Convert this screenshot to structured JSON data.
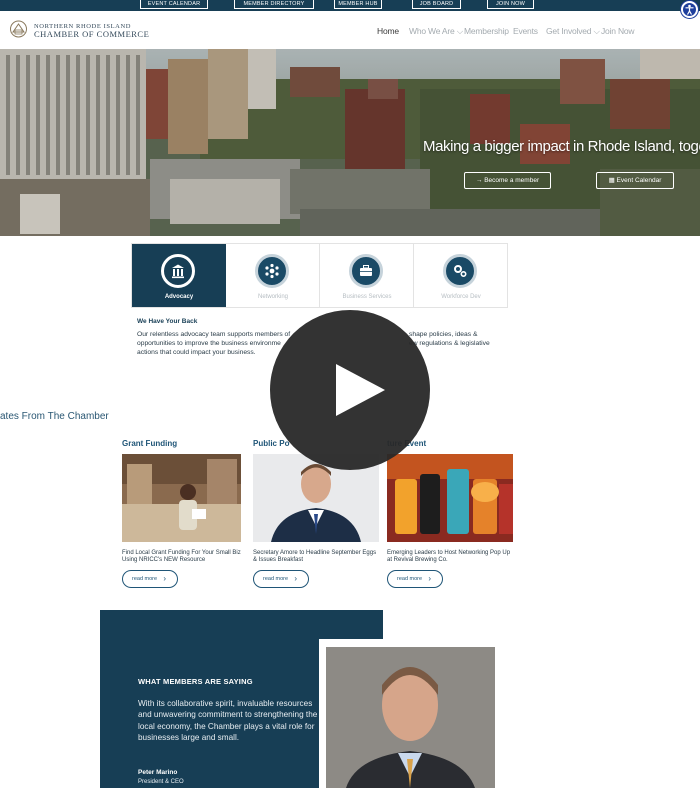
{
  "utility_bar": {
    "items": [
      "EVENT CALENDAR",
      "MEMBER DIRECTORY",
      "MEMBER HUB",
      "JOB BOARD",
      "JOIN NOW"
    ]
  },
  "logo": {
    "line1": "Northern Rhode Island",
    "line2": "Chamber of Commerce"
  },
  "nav": {
    "items": [
      {
        "label": "Home"
      },
      {
        "label": "Who We Are ⌵"
      },
      {
        "label": "Membership"
      },
      {
        "label": "Events"
      },
      {
        "label": "Get Involved ⌵"
      },
      {
        "label": "Join Now"
      }
    ]
  },
  "hero": {
    "headline": "Making a bigger impact in Rhode Island, together",
    "btn_member": "→  Become a member",
    "btn_calendar": "▦  Event Calendar"
  },
  "tabs": [
    {
      "label": "Advocacy",
      "icon": "bank-icon"
    },
    {
      "label": "Networking",
      "icon": "people-network-icon"
    },
    {
      "label": "Business Services",
      "icon": "briefcase-icon"
    },
    {
      "label": "Workforce Dev",
      "icon": "gears-icon"
    }
  ],
  "advocacy": {
    "title": "We Have Your Back",
    "body_line1": "Our relentless advocacy team supports members of",
    "body_line1b": "shape policies, ideas &",
    "body_line2": "opportunities to improve the business environme",
    "body_line2b": "ew regulations & legislative",
    "body_line3": "actions that could impact your business."
  },
  "updates": {
    "title": "ates From The Chamber"
  },
  "news": [
    {
      "category": "Grant Funding",
      "title": "Find Local Grant Funding For Your Small Biz Using NRICC's NEW Resource",
      "read_more": "read more"
    },
    {
      "category": "Public Po",
      "title": "Secretary Amore to Headline September Eggs & Issues Breakfast",
      "read_more": "read more"
    },
    {
      "category": "ture Event",
      "title": "Emerging Leaders to Host Networking Pop Up at Revival Brewing Co.",
      "read_more": "read more"
    }
  ],
  "testimonial": {
    "heading": "WHAT MEMBERS ARE SAYING",
    "quote": "With its collaborative spirit, invaluable resources and unwavering commitment to strengthening the local economy, the Chamber  plays a vital role for businesses large and small.",
    "name": "Peter Marino",
    "role": "President  & CEO"
  },
  "colors": {
    "navy": "#173e55",
    "accent_blue": "#1f5577",
    "accessibility": "#1f3f9d"
  }
}
